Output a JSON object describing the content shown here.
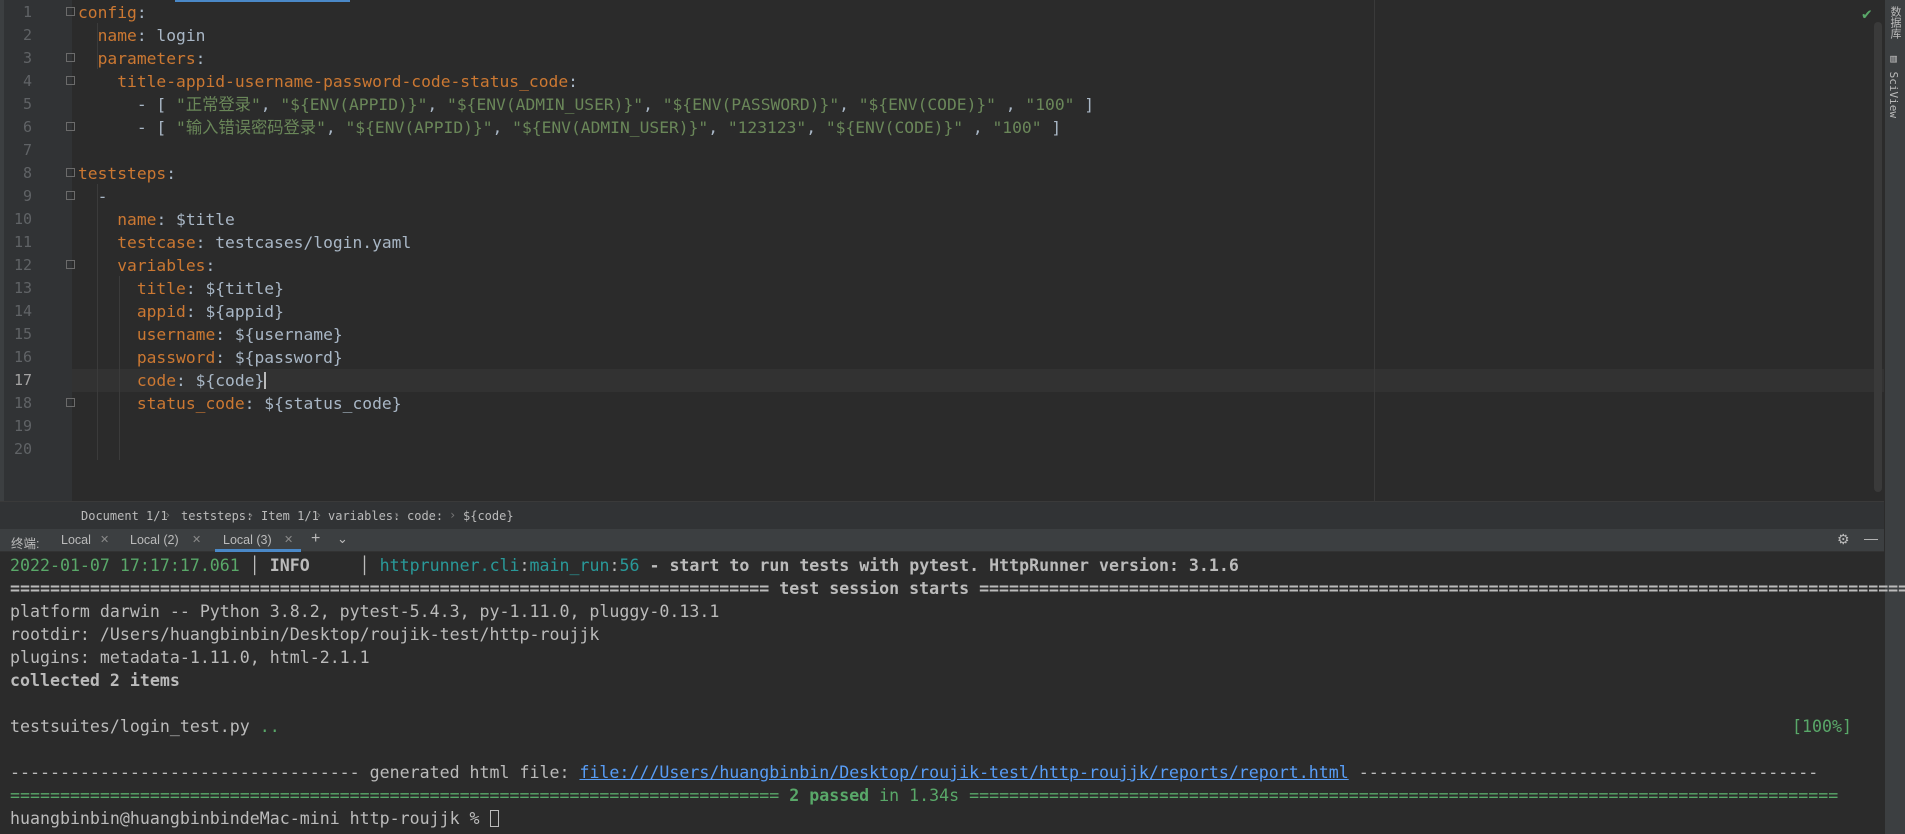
{
  "editor": {
    "lines": [
      {
        "n": "1",
        "segs": [
          {
            "t": "config",
            "c": "k"
          },
          {
            "t": ":",
            "c": "v"
          }
        ]
      },
      {
        "n": "2",
        "segs": [
          {
            "t": "  "
          },
          {
            "t": "name",
            "c": "k"
          },
          {
            "t": ": login",
            "c": "v"
          }
        ]
      },
      {
        "n": "3",
        "segs": [
          {
            "t": "  "
          },
          {
            "t": "parameters",
            "c": "k"
          },
          {
            "t": ":",
            "c": "v"
          }
        ]
      },
      {
        "n": "4",
        "segs": [
          {
            "t": "    "
          },
          {
            "t": "title-appid-username-password-code-status_code",
            "c": "k"
          },
          {
            "t": ":",
            "c": "v"
          }
        ]
      },
      {
        "n": "5",
        "segs": [
          {
            "t": "      - [ ",
            "c": "v"
          },
          {
            "t": "\"正常登录\"",
            "c": "s"
          },
          {
            "t": ", ",
            "c": "v"
          },
          {
            "t": "\"${ENV(APPID)}\"",
            "c": "s"
          },
          {
            "t": ", ",
            "c": "v"
          },
          {
            "t": "\"${ENV(ADMIN_USER)}\"",
            "c": "s"
          },
          {
            "t": ", ",
            "c": "v"
          },
          {
            "t": "\"${ENV(PASSWORD)}\"",
            "c": "s"
          },
          {
            "t": ", ",
            "c": "v"
          },
          {
            "t": "\"${ENV(CODE)}\"",
            "c": "s"
          },
          {
            "t": " , ",
            "c": "v"
          },
          {
            "t": "\"100\"",
            "c": "s"
          },
          {
            "t": " ]",
            "c": "v"
          }
        ]
      },
      {
        "n": "6",
        "segs": [
          {
            "t": "      - [ ",
            "c": "v"
          },
          {
            "t": "\"输入错误密码登录\"",
            "c": "s"
          },
          {
            "t": ", ",
            "c": "v"
          },
          {
            "t": "\"${ENV(APPID)}\"",
            "c": "s"
          },
          {
            "t": ", ",
            "c": "v"
          },
          {
            "t": "\"${ENV(ADMIN_USER)}\"",
            "c": "s"
          },
          {
            "t": ", ",
            "c": "v"
          },
          {
            "t": "\"123123\"",
            "c": "s"
          },
          {
            "t": ", ",
            "c": "v"
          },
          {
            "t": "\"${ENV(CODE)}\"",
            "c": "s"
          },
          {
            "t": " , ",
            "c": "v"
          },
          {
            "t": "\"100\"",
            "c": "s"
          },
          {
            "t": " ]",
            "c": "v"
          }
        ]
      },
      {
        "n": "7",
        "segs": []
      },
      {
        "n": "8",
        "segs": [
          {
            "t": "teststeps",
            "c": "k"
          },
          {
            "t": ":",
            "c": "v"
          }
        ]
      },
      {
        "n": "9",
        "segs": [
          {
            "t": "  -",
            "c": "v"
          }
        ]
      },
      {
        "n": "10",
        "segs": [
          {
            "t": "    "
          },
          {
            "t": "name",
            "c": "k"
          },
          {
            "t": ": $title",
            "c": "v"
          }
        ]
      },
      {
        "n": "11",
        "segs": [
          {
            "t": "    "
          },
          {
            "t": "testcase",
            "c": "k"
          },
          {
            "t": ": testcases/login.yaml",
            "c": "v"
          }
        ]
      },
      {
        "n": "12",
        "segs": [
          {
            "t": "    "
          },
          {
            "t": "variables",
            "c": "k"
          },
          {
            "t": ":",
            "c": "v"
          }
        ]
      },
      {
        "n": "13",
        "segs": [
          {
            "t": "      "
          },
          {
            "t": "title",
            "c": "k"
          },
          {
            "t": ": ${title}",
            "c": "v"
          }
        ]
      },
      {
        "n": "14",
        "segs": [
          {
            "t": "      "
          },
          {
            "t": "appid",
            "c": "k"
          },
          {
            "t": ": ${appid}",
            "c": "v"
          }
        ]
      },
      {
        "n": "15",
        "segs": [
          {
            "t": "      "
          },
          {
            "t": "username",
            "c": "k"
          },
          {
            "t": ": ${username}",
            "c": "v"
          }
        ]
      },
      {
        "n": "16",
        "segs": [
          {
            "t": "      "
          },
          {
            "t": "password",
            "c": "k"
          },
          {
            "t": ": ${password}",
            "c": "v"
          }
        ]
      },
      {
        "n": "17",
        "segs": [
          {
            "t": "      "
          },
          {
            "t": "code",
            "c": "k"
          },
          {
            "t": ": ${code}",
            "c": "v"
          }
        ]
      },
      {
        "n": "18",
        "segs": [
          {
            "t": "      "
          },
          {
            "t": "status_code",
            "c": "k"
          },
          {
            "t": ": ${status_code}",
            "c": "v"
          }
        ]
      },
      {
        "n": "19",
        "segs": []
      },
      {
        "n": "20",
        "segs": []
      }
    ],
    "current_line": "17",
    "fold_lines": [
      "1",
      "3",
      "4",
      "6",
      "8",
      "9",
      "12",
      "18"
    ]
  },
  "breadcrumb": [
    "Document 1/1",
    "teststeps:",
    "Item 1/1",
    "variables:",
    "code:",
    "${code}"
  ],
  "terminal": {
    "label": "终端:",
    "tabs": [
      "Local",
      "Local (2)",
      "Local (3)"
    ],
    "active_tab": "Local (3)",
    "add_symbol": "+",
    "log_time": "2022-01-07 17:17:17.061",
    "log_level": "INFO",
    "log_module": "httprunner.cli",
    "log_func": "main_run",
    "log_lineno": "56",
    "log_message": " - start to run tests with pytest. HttpRunner version: 3.1.6",
    "session_rule_left": "============================================================================",
    "session_title": " test session starts ",
    "session_rule_right": "======================================================================================================",
    "platform": "platform darwin -- Python 3.8.2, pytest-5.4.3, py-1.11.0, pluggy-0.13.1",
    "rootdir": "rootdir: /Users/huangbinbin/Desktop/roujik-test/http-roujjk",
    "plugins": "plugins: metadata-1.11.0, html-2.1.1",
    "collected": "collected 2 items",
    "test_file": "testsuites/login_test.py ",
    "test_dots": "..",
    "percent": "[100%]",
    "gen_left": "----------------------------------- generated html file: ",
    "report_link": "file:///Users/huangbinbin/Desktop/roujik-test/http-roujjk/reports/report.html",
    "gen_right": " ----------------------------------------------",
    "passed_left": "============================================================================= ",
    "passed_text": "2 passed",
    "passed_time": " in 1.34s ",
    "passed_right": "=======================================================================================",
    "prompt": "huangbinbin@huangbinbindeMac-mini http-roujjk % "
  },
  "right_strip": {
    "label_top": "数据库",
    "label_sciview": "SciView"
  }
}
